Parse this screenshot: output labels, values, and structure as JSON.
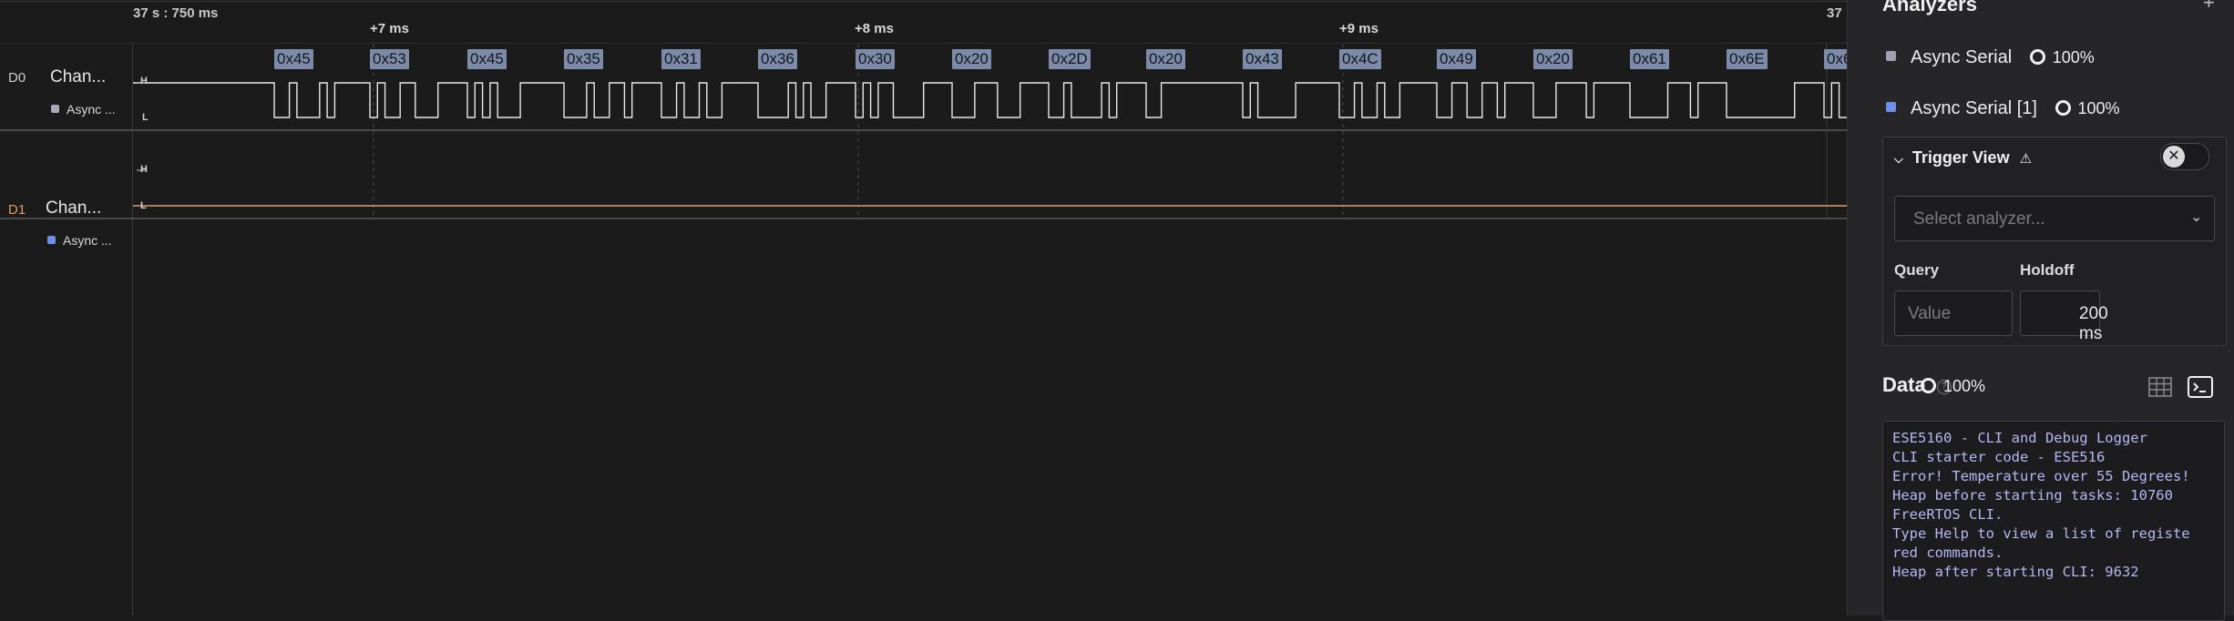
{
  "timeline": {
    "origin": "37 s : 750 ms",
    "right_label": "37",
    "ticks": [
      "+7 ms",
      "+8 ms",
      "+9 ms"
    ]
  },
  "channels": [
    {
      "id": "D0",
      "name": "Chan...",
      "analyzer": "Async ...",
      "color": "#cfcfcf",
      "dot": "#a8a8b8"
    },
    {
      "id": "D1",
      "name": "Chan...",
      "analyzer": "Async ...",
      "color": "#e39a6a",
      "dot": "#6f8ee8"
    }
  ],
  "levels": {
    "high": "H",
    "low": "L"
  },
  "bytes": [
    "0x45",
    "0x53",
    "0x45",
    "0x35",
    "0x31",
    "0x36",
    "0x30",
    "0x20",
    "0x2D",
    "0x20",
    "0x43",
    "0x4C",
    "0x49",
    "0x20",
    "0x61",
    "0x6E",
    "0x6"
  ],
  "panel": {
    "title": "Analyzers",
    "add": "+",
    "analyzers": [
      {
        "name": "Async Serial",
        "percent": "100%",
        "color": "#a0a0b4"
      },
      {
        "name": "Async Serial [1]",
        "percent": "100%",
        "color": "#6f8ee8"
      }
    ],
    "trigger": {
      "title": "Trigger View",
      "warn": "⚠",
      "select_placeholder": "Select analyzer...",
      "query_label": "Query",
      "query_placeholder": "Value",
      "holdoff_label": "Holdoff",
      "holdoff_value": "200 ms"
    },
    "data": {
      "title": "Data",
      "help": "?",
      "percent": "100%",
      "console": [
        "ESE5160 - CLI and Debug Logger",
        "CLI starter code - ESE516",
        "Error! Temperature over 55 Degrees!",
        "Heap before starting tasks: 10760",
        "FreeRTOS CLI.",
        "Type Help to view a list of registe",
        "red commands.",
        "Heap after starting CLI: 9632"
      ]
    }
  }
}
